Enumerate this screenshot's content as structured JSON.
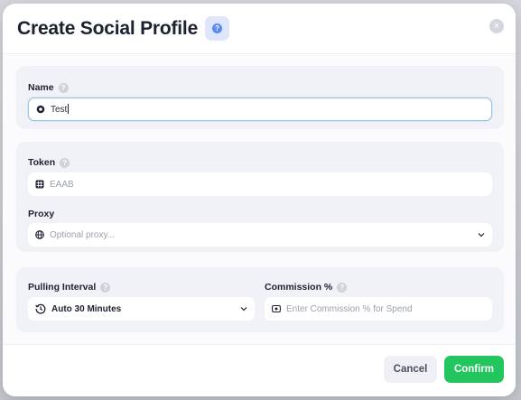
{
  "modal": {
    "title": "Create Social Profile",
    "close_symbol": "×",
    "help_symbol": "?"
  },
  "fields": {
    "name": {
      "label": "Name",
      "value": "Test",
      "icon": "circle-dot-icon"
    },
    "token": {
      "label": "Token",
      "placeholder": "EAAB",
      "icon": "grid-icon"
    },
    "proxy": {
      "label": "Proxy",
      "placeholder": "Optional proxy...",
      "icon": "globe-icon"
    },
    "pulling_interval": {
      "label": "Pulling Interval",
      "value": "Auto 30 Minutes",
      "icon": "history-icon"
    },
    "commission": {
      "label": "Commission %",
      "placeholder": "Enter Commission % for Spend",
      "icon": "coin-icon"
    }
  },
  "help_glyph": "?",
  "footer": {
    "cancel_label": "Cancel",
    "confirm_label": "Confirm"
  },
  "colors": {
    "confirm": "#22c55e",
    "help_badge_bg": "#dfe6fb",
    "help_dot": "#5b8af0",
    "section_bg": "#f1f2f7"
  }
}
